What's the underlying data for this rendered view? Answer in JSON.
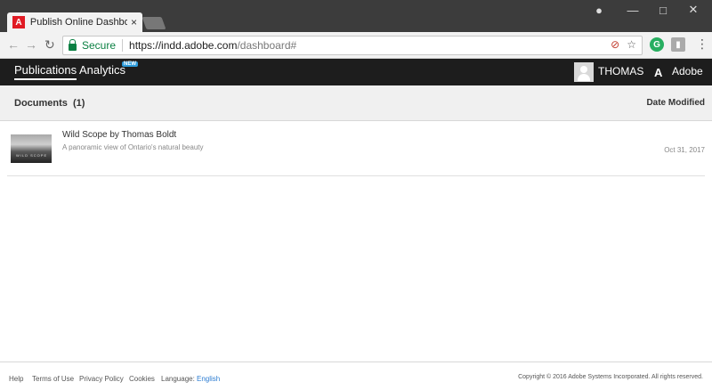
{
  "browser": {
    "tab_title": "Publish Online Dashboard",
    "tab_close": "×",
    "favicon": "A",
    "back": "←",
    "forward": "→",
    "reload": "↻",
    "secure_label": "Secure",
    "url_host": "https://indd.adobe.com",
    "url_path": "/dashboard#",
    "minimize": "—",
    "maximize": "□",
    "close": "✕",
    "profile": "●",
    "star": "☆",
    "menu": "⋮",
    "ext1": "G",
    "ext2": "▮"
  },
  "appbar": {
    "publications": "Publications",
    "analytics": "Analytics",
    "new_badge": "NEW",
    "user_name": "THOMAS",
    "adobe_logo": "A",
    "adobe_label": "Adobe"
  },
  "documents": {
    "title": "Documents  (1)",
    "date_modified": "Date Modified",
    "items": [
      {
        "thumb_text": "WILD SCOPE",
        "title": "Wild Scope by Thomas Boldt",
        "description": "A panoramic view of Ontario's natural beauty",
        "date": "Oct 31, 2017"
      }
    ]
  },
  "footer": {
    "help": "Help",
    "terms": "Terms of Use",
    "privacy": "Privacy Policy",
    "cookies": "Cookies",
    "language_label": "Language:",
    "language": "English",
    "copyright": "Copyright © 2016 Adobe Systems Incorporated. All rights reserved."
  }
}
